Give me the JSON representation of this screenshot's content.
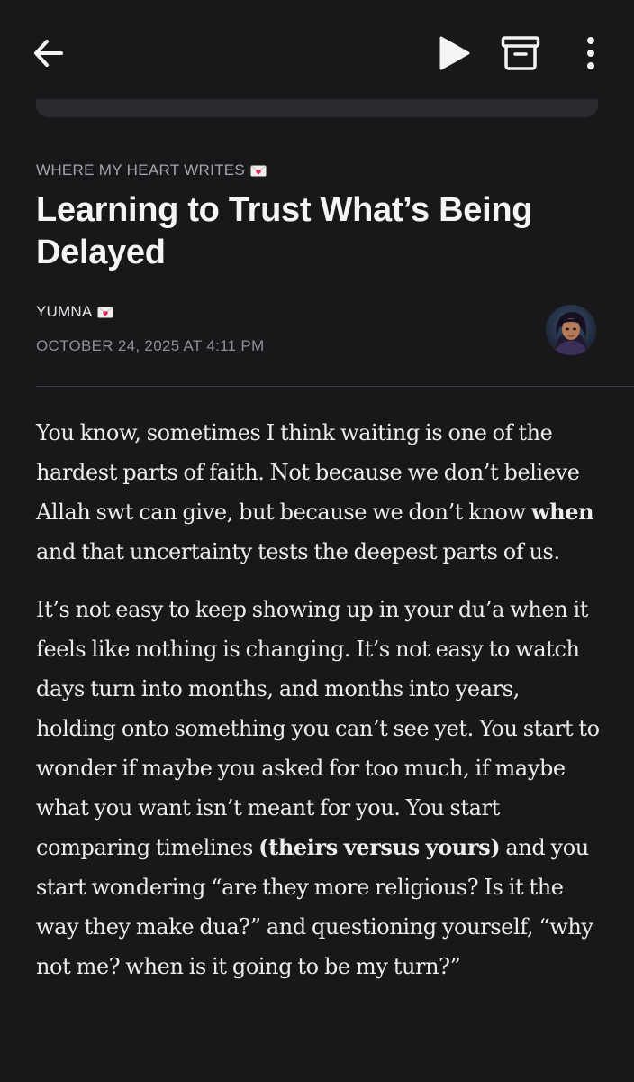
{
  "toolbar": {
    "back_icon": "arrow-left-icon",
    "play_icon": "play-icon",
    "archive_icon": "archive-icon",
    "more_icon": "more-vertical-icon"
  },
  "article": {
    "publication": "WHERE MY HEART WRITES",
    "publication_emoji": "love-letter-icon",
    "title": "Learning to Trust What’s Being Delayed",
    "author": "YUMNA",
    "author_emoji": "love-letter-icon",
    "date": "OCTOBER 24, 2025 AT 4:11 PM",
    "avatar": "author-avatar",
    "paragraphs": [
      {
        "p1_a": "You know, sometimes I think waiting is one of the hardest parts of faith. Not because we don’t believe Allah swt can give, but because we don’t know ",
        "p1_bold": "when",
        "p1_b": " and that uncertainty tests the deepest parts of us."
      },
      {
        "p2_a": "It’s not easy to keep showing up in your du’a when it feels like nothing is changing. It’s not easy to watch days turn into months, and months into years, holding onto something you can’t see yet. You start to wonder if maybe you asked for too much, if maybe what you want isn’t meant for you. You start comparing timelines ",
        "p2_bold": "(theirs versus yours)",
        "p2_b": " and you start wondering “are they more religious? Is it the way they make dua?” and questioning yourself, “why not me? when is it going to be my turn?”"
      }
    ]
  },
  "colors": {
    "background": "#18181b",
    "text": "#ececec",
    "muted": "#8e8e94",
    "envelope": "#f3eeee",
    "heart": "#e0245e"
  }
}
